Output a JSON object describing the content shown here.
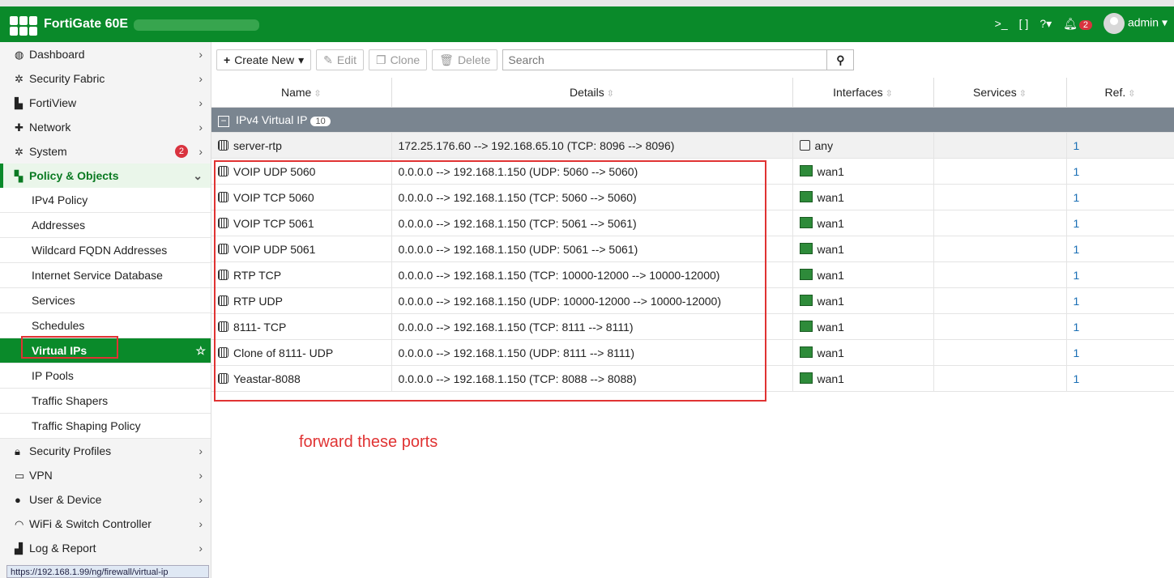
{
  "header": {
    "device_name": "FortiGate 60E",
    "user": "admin",
    "notif_count": "2"
  },
  "sidebar": {
    "top_items": [
      {
        "label": "Dashboard",
        "icon": "dashboard-icon"
      },
      {
        "label": "Security Fabric",
        "icon": "security-fabric-icon"
      },
      {
        "label": "FortiView",
        "icon": "fortiview-icon"
      },
      {
        "label": "Network",
        "icon": "network-icon"
      },
      {
        "label": "System",
        "icon": "system-icon",
        "badge": "2"
      },
      {
        "label": "Policy & Objects",
        "icon": "policy-icon"
      }
    ],
    "sub_items": [
      "IPv4 Policy",
      "Addresses",
      "Wildcard FQDN Addresses",
      "Internet Service Database",
      "Services",
      "Schedules",
      "Virtual IPs",
      "IP Pools",
      "Traffic Shapers",
      "Traffic Shaping Policy"
    ],
    "bottom_items": [
      {
        "label": "Security Profiles",
        "icon": "lock-icon"
      },
      {
        "label": "VPN",
        "icon": "vpn-icon"
      },
      {
        "label": "User & Device",
        "icon": "user-icon"
      },
      {
        "label": "WiFi & Switch Controller",
        "icon": "wifi-icon"
      },
      {
        "label": "Log & Report",
        "icon": "log-icon"
      }
    ],
    "status_url": "https://192.168.1.99/ng/firewall/virtual-ip"
  },
  "toolbar": {
    "create_new": "Create New",
    "edit": "Edit",
    "clone": "Clone",
    "delete": "Delete",
    "search_placeholder": "Search"
  },
  "table": {
    "headers": [
      "Name",
      "Details",
      "Interfaces",
      "Services",
      "Ref."
    ],
    "group": {
      "label": "IPv4 Virtual IP",
      "count": "10"
    },
    "rows": [
      {
        "name": "server-rtp",
        "details": "172.25.176.60 --> 192.168.65.10 (TCP: 8096 --> 8096)",
        "iface": "any",
        "services": "",
        "ref": "1"
      },
      {
        "name": "VOIP UDP 5060",
        "details": "0.0.0.0 --> 192.168.1.150 (UDP: 5060 --> 5060)",
        "iface": "wan1",
        "services": "",
        "ref": "1"
      },
      {
        "name": "VOIP TCP 5060",
        "details": "0.0.0.0 --> 192.168.1.150 (TCP: 5060 --> 5060)",
        "iface": "wan1",
        "services": "",
        "ref": "1"
      },
      {
        "name": "VOIP TCP 5061",
        "details": "0.0.0.0 --> 192.168.1.150 (TCP: 5061 --> 5061)",
        "iface": "wan1",
        "services": "",
        "ref": "1"
      },
      {
        "name": "VOIP UDP 5061",
        "details": "0.0.0.0 --> 192.168.1.150 (UDP: 5061 --> 5061)",
        "iface": "wan1",
        "services": "",
        "ref": "1"
      },
      {
        "name": "RTP TCP",
        "details": "0.0.0.0 --> 192.168.1.150 (TCP: 10000-12000 --> 10000-12000)",
        "iface": "wan1",
        "services": "",
        "ref": "1"
      },
      {
        "name": "RTP UDP",
        "details": "0.0.0.0 --> 192.168.1.150 (UDP: 10000-12000 --> 10000-12000)",
        "iface": "wan1",
        "services": "",
        "ref": "1"
      },
      {
        "name": "8111- TCP",
        "details": "0.0.0.0 --> 192.168.1.150 (TCP: 8111 --> 8111)",
        "iface": "wan1",
        "services": "",
        "ref": "1"
      },
      {
        "name": "Clone of 8111- UDP",
        "details": "0.0.0.0 --> 192.168.1.150 (UDP: 8111 --> 8111)",
        "iface": "wan1",
        "services": "",
        "ref": "1"
      },
      {
        "name": "Yeastar-8088",
        "details": "0.0.0.0 --> 192.168.1.150 (TCP: 8088 --> 8088)",
        "iface": "wan1",
        "services": "",
        "ref": "1"
      }
    ]
  },
  "annotation": {
    "note": "forward these ports"
  },
  "colors": {
    "brand_green": "#0a8a2a",
    "highlight_red": "#e03333",
    "link_blue": "#1a6fb5"
  }
}
